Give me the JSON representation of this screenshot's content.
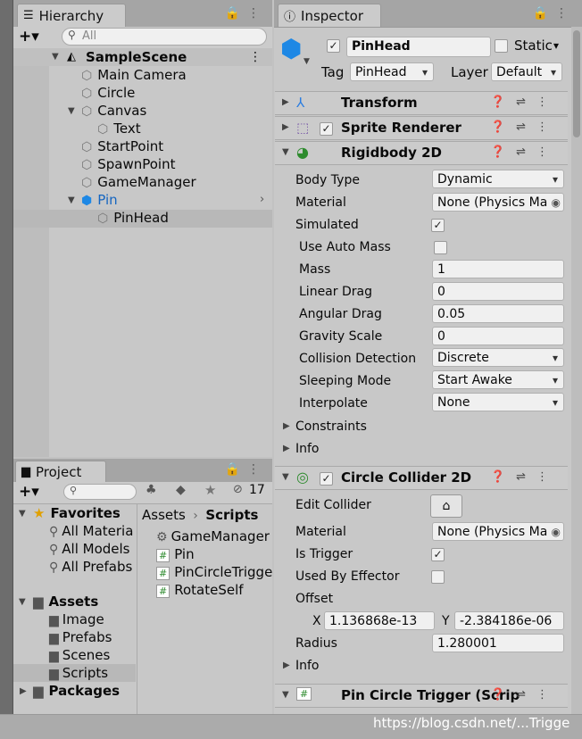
{
  "hierarchy": {
    "tab": "Hierarchy",
    "add_label": "+▾",
    "search_placeholder": "All",
    "items": [
      {
        "label": "SampleScene"
      },
      {
        "label": "Main Camera"
      },
      {
        "label": "Circle"
      },
      {
        "label": "Canvas"
      },
      {
        "label": "Text"
      },
      {
        "label": "StartPoint"
      },
      {
        "label": "SpawnPoint"
      },
      {
        "label": "GameManager"
      },
      {
        "label": "Pin"
      },
      {
        "label": "PinHead"
      }
    ]
  },
  "project": {
    "tab": "Project",
    "add_label": "+▾",
    "hidden_count": "17",
    "favorites": {
      "label": "Favorites",
      "items": [
        "All Materia",
        "All Models",
        "All Prefabs"
      ]
    },
    "assets": {
      "label": "Assets",
      "items": [
        "Image",
        "Prefabs",
        "Scenes",
        "Scripts"
      ]
    },
    "packages": "Packages",
    "breadcrumb": {
      "root": "Assets",
      "current": "Scripts"
    },
    "files": [
      "GameManager",
      "Pin",
      "PinCircleTrigge",
      "RotateSelf"
    ]
  },
  "inspector": {
    "tab": "Inspector",
    "object_name": "PinHead",
    "static_label": "Static",
    "tag_label": "Tag",
    "tag_value": "PinHead",
    "layer_label": "Layer",
    "layer_value": "Default",
    "components": {
      "transform": "Transform",
      "sprite_renderer": "Sprite Renderer",
      "rigidbody": "Rigidbody 2D",
      "circle_collider": "Circle Collider 2D",
      "pin_trigger": "Pin Circle Trigger (Scrip"
    },
    "rigidbody": {
      "body_type": {
        "label": "Body Type",
        "value": "Dynamic"
      },
      "material": {
        "label": "Material",
        "value": "None (Physics Ma"
      },
      "simulated": {
        "label": "Simulated",
        "checked": true
      },
      "use_auto_mass": {
        "label": "Use Auto Mass",
        "checked": false
      },
      "mass": {
        "label": "Mass",
        "value": "1"
      },
      "linear_drag": {
        "label": "Linear Drag",
        "value": "0"
      },
      "angular_drag": {
        "label": "Angular Drag",
        "value": "0.05"
      },
      "gravity_scale": {
        "label": "Gravity Scale",
        "value": "0"
      },
      "collision_detection": {
        "label": "Collision Detection",
        "value": "Discrete"
      },
      "sleeping_mode": {
        "label": "Sleeping Mode",
        "value": "Start Awake"
      },
      "interpolate": {
        "label": "Interpolate",
        "value": "None"
      },
      "constraints": "Constraints",
      "info": "Info"
    },
    "circle_collider": {
      "edit_collider": "Edit Collider",
      "material": {
        "label": "Material",
        "value": "None (Physics Ma"
      },
      "is_trigger": {
        "label": "Is Trigger",
        "checked": true
      },
      "used_by_effector": {
        "label": "Used By Effector",
        "checked": false
      },
      "offset": {
        "label": "Offset",
        "x_label": "X",
        "x": "1.136868e-13",
        "y_label": "Y",
        "y": "-2.384186e-06"
      },
      "radius": {
        "label": "Radius",
        "value": "1.280001"
      },
      "info": "Info"
    }
  },
  "watermark": "https://blog.csdn.net/...Trigge",
  "colors": {
    "selection": "#b8b8b8",
    "pin_blue": "#1565c0",
    "favorite_star": "#e0a000",
    "accent_icon": "#2e8b2e"
  }
}
